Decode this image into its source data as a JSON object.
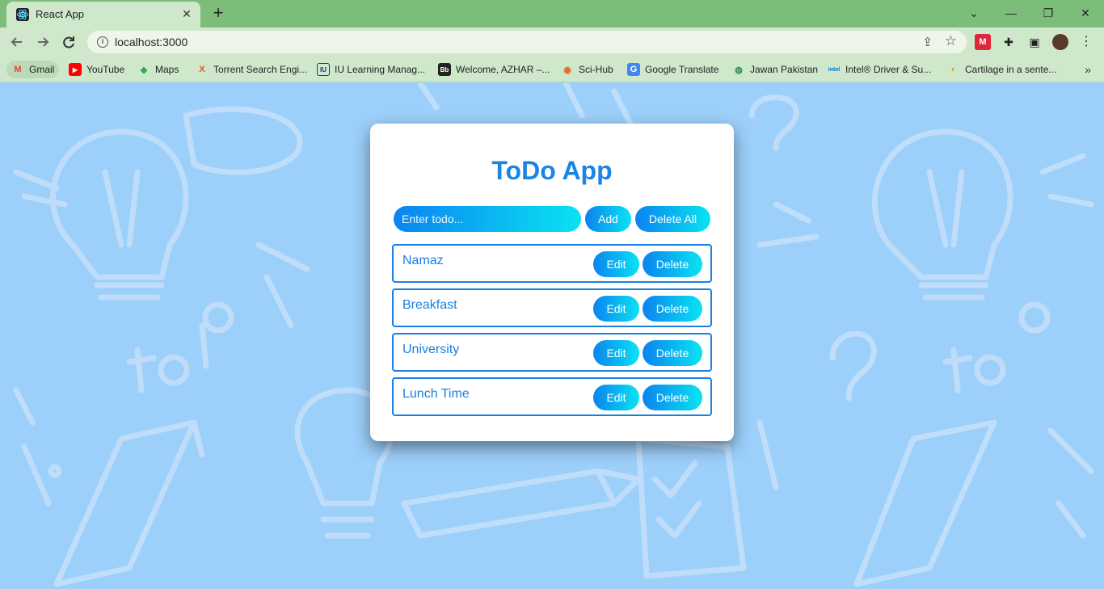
{
  "browser": {
    "tab_title": "React App",
    "tab_close": "✕",
    "new_tab": "+",
    "window_controls": {
      "minimize": "—",
      "restore": "❐",
      "close": "✕",
      "tab_search": "⌄"
    },
    "url": "localhost:3000",
    "bookmarks": [
      {
        "label": "Gmail",
        "icon": "gmail-icon",
        "glyph": "M",
        "color": "#ea4335"
      },
      {
        "label": "YouTube",
        "icon": "youtube-icon",
        "glyph": "▶",
        "color": "#ff0000"
      },
      {
        "label": "Maps",
        "icon": "maps-icon",
        "glyph": "◆",
        "color": "#34a853"
      },
      {
        "label": "Torrent Search Engi...",
        "icon": "torrent-icon",
        "glyph": "X",
        "color": "#e8541f"
      },
      {
        "label": "IU Learning Manag...",
        "icon": "iu-icon",
        "glyph": "IU",
        "color": "#1a3a7a"
      },
      {
        "label": "Welcome, AZHAR –...",
        "icon": "bb-icon",
        "glyph": "Bb",
        "color": "#222222"
      },
      {
        "label": "Sci-Hub",
        "icon": "scihub-icon",
        "glyph": "◉",
        "color": "#e06a1a"
      },
      {
        "label": "Google Translate",
        "icon": "translate-icon",
        "glyph": "G",
        "color": "#4285f4"
      },
      {
        "label": "Jawan Pakistan",
        "icon": "jawan-icon",
        "glyph": "◍",
        "color": "#2e8b57"
      },
      {
        "label": "Intel® Driver & Su...",
        "icon": "intel-icon",
        "glyph": "intel",
        "color": "#0071c5"
      },
      {
        "label": "Cartilage in a sente...",
        "icon": "cartilage-icon",
        "glyph": "◐",
        "color": "#f0a020"
      }
    ],
    "more_bookmarks": "»"
  },
  "app": {
    "title": "ToDo App",
    "input_placeholder": "Enter todo...",
    "add_label": "Add",
    "delete_all_label": "Delete All",
    "edit_label": "Edit",
    "delete_label": "Delete",
    "todos": [
      "Namaz",
      "Breakfast",
      "University",
      "Lunch Time"
    ]
  },
  "colors": {
    "page_bg": "#9ccffa",
    "accent": "#1a85e6",
    "gradient_start": "#0a84f0",
    "gradient_end": "#0ae3f2",
    "chrome_bg": "#cfe8cc",
    "titlebar_bg": "#7dbd7a"
  }
}
